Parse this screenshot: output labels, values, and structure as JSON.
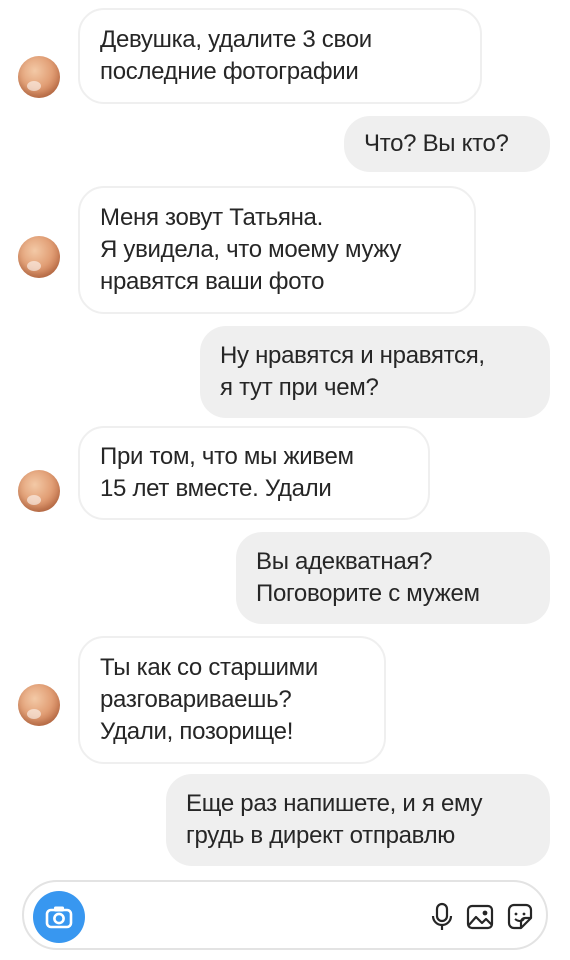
{
  "messages": [
    {
      "sender": "other",
      "lines": [
        "Девушка, удалите 3 свои",
        "последние фотографии"
      ]
    },
    {
      "sender": "me",
      "lines": [
        "Что? Вы кто?"
      ]
    },
    {
      "sender": "other",
      "lines": [
        "Меня зовут Татьяна.",
        "Я увидела, что моему мужу",
        "нравятся ваши фото"
      ]
    },
    {
      "sender": "me",
      "lines": [
        "Ну нравятся и нравятся,",
        "я тут при чем?"
      ]
    },
    {
      "sender": "other",
      "lines": [
        "При том, что мы живем",
        "15 лет вместе. Удали"
      ]
    },
    {
      "sender": "me",
      "lines": [
        "Вы адекватная?",
        "Поговорите с мужем"
      ]
    },
    {
      "sender": "other",
      "lines": [
        "Ты как со старшими",
        "разговариваешь?",
        "Удали, позорище!"
      ]
    },
    {
      "sender": "me",
      "lines": [
        "Еще раз напишете, и я ему",
        "грудь в директ отправлю"
      ]
    }
  ],
  "composer": {
    "placeholder": "",
    "icons": [
      "camera-icon",
      "microphone-icon",
      "image-icon",
      "sticker-icon"
    ],
    "accent": "#3897f0"
  },
  "colors": {
    "incoming_border": "#efefef",
    "outgoing_bg": "#efefef",
    "text": "#262626"
  }
}
